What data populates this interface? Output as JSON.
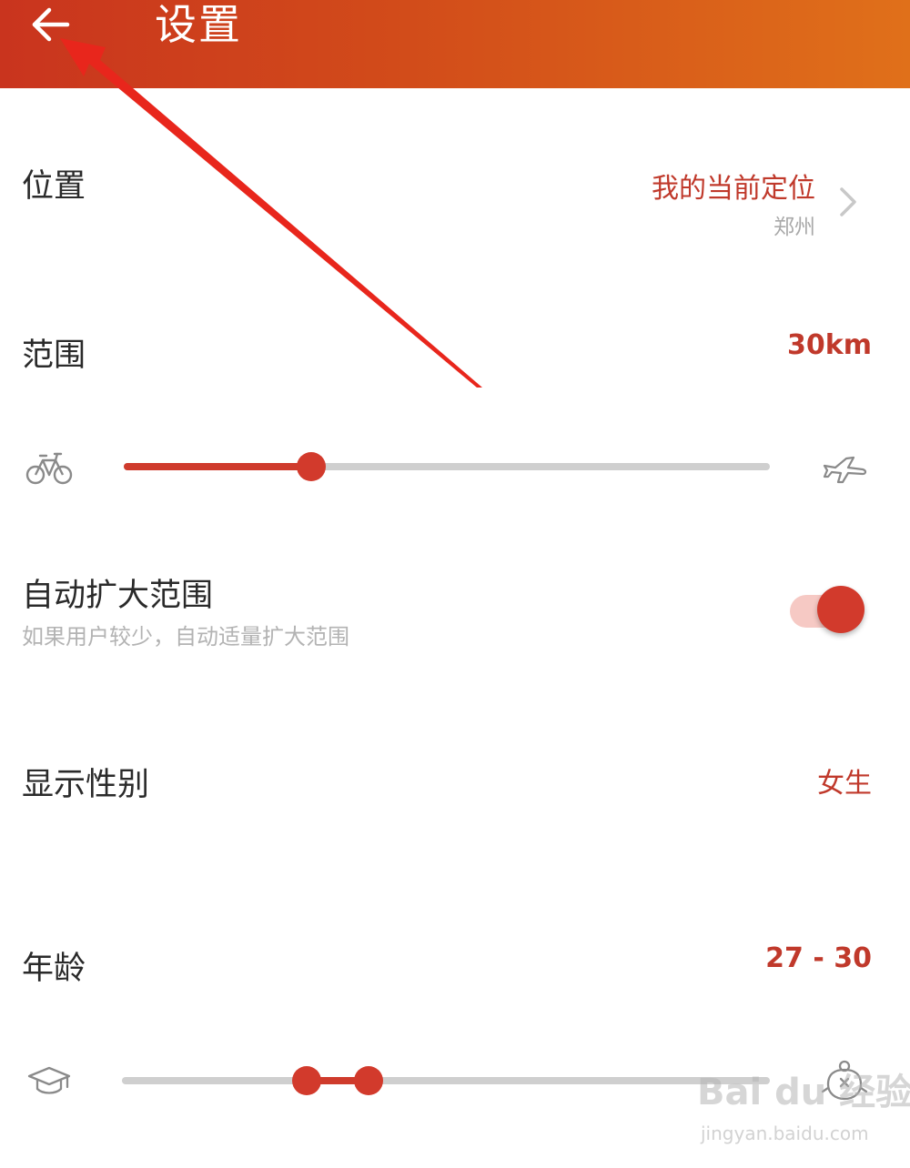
{
  "header": {
    "title": "设置"
  },
  "settings": {
    "location": {
      "label": "位置",
      "value": "我的当前定位",
      "city": "郑州"
    },
    "range": {
      "label": "范围",
      "value": "30km",
      "slider_fraction": 0.29
    },
    "auto_expand": {
      "label": "自动扩大范围",
      "description": "如果用户较少，自动适量扩大范围",
      "enabled": true
    },
    "gender": {
      "label": "显示性别",
      "value": "女生"
    },
    "age": {
      "label": "年龄",
      "value": "27 - 30",
      "range_low_fraction": 0.285,
      "range_high_fraction": 0.38
    }
  },
  "watermark": {
    "main": "Bai du 经验",
    "sub": "jingyan.baidu.com"
  },
  "icons": {
    "back": "arrow-left-icon",
    "chevron": "chevron-right-icon",
    "bicycle": "bicycle-icon",
    "airplane": "airplane-icon",
    "graduation_cap": "graduation-cap-icon",
    "elder": "elder-face-icon"
  },
  "colors": {
    "accent": "#d23a2c",
    "header_start": "#c9341e",
    "header_end": "#e0701a",
    "secondary_text": "#b3b3b3"
  }
}
